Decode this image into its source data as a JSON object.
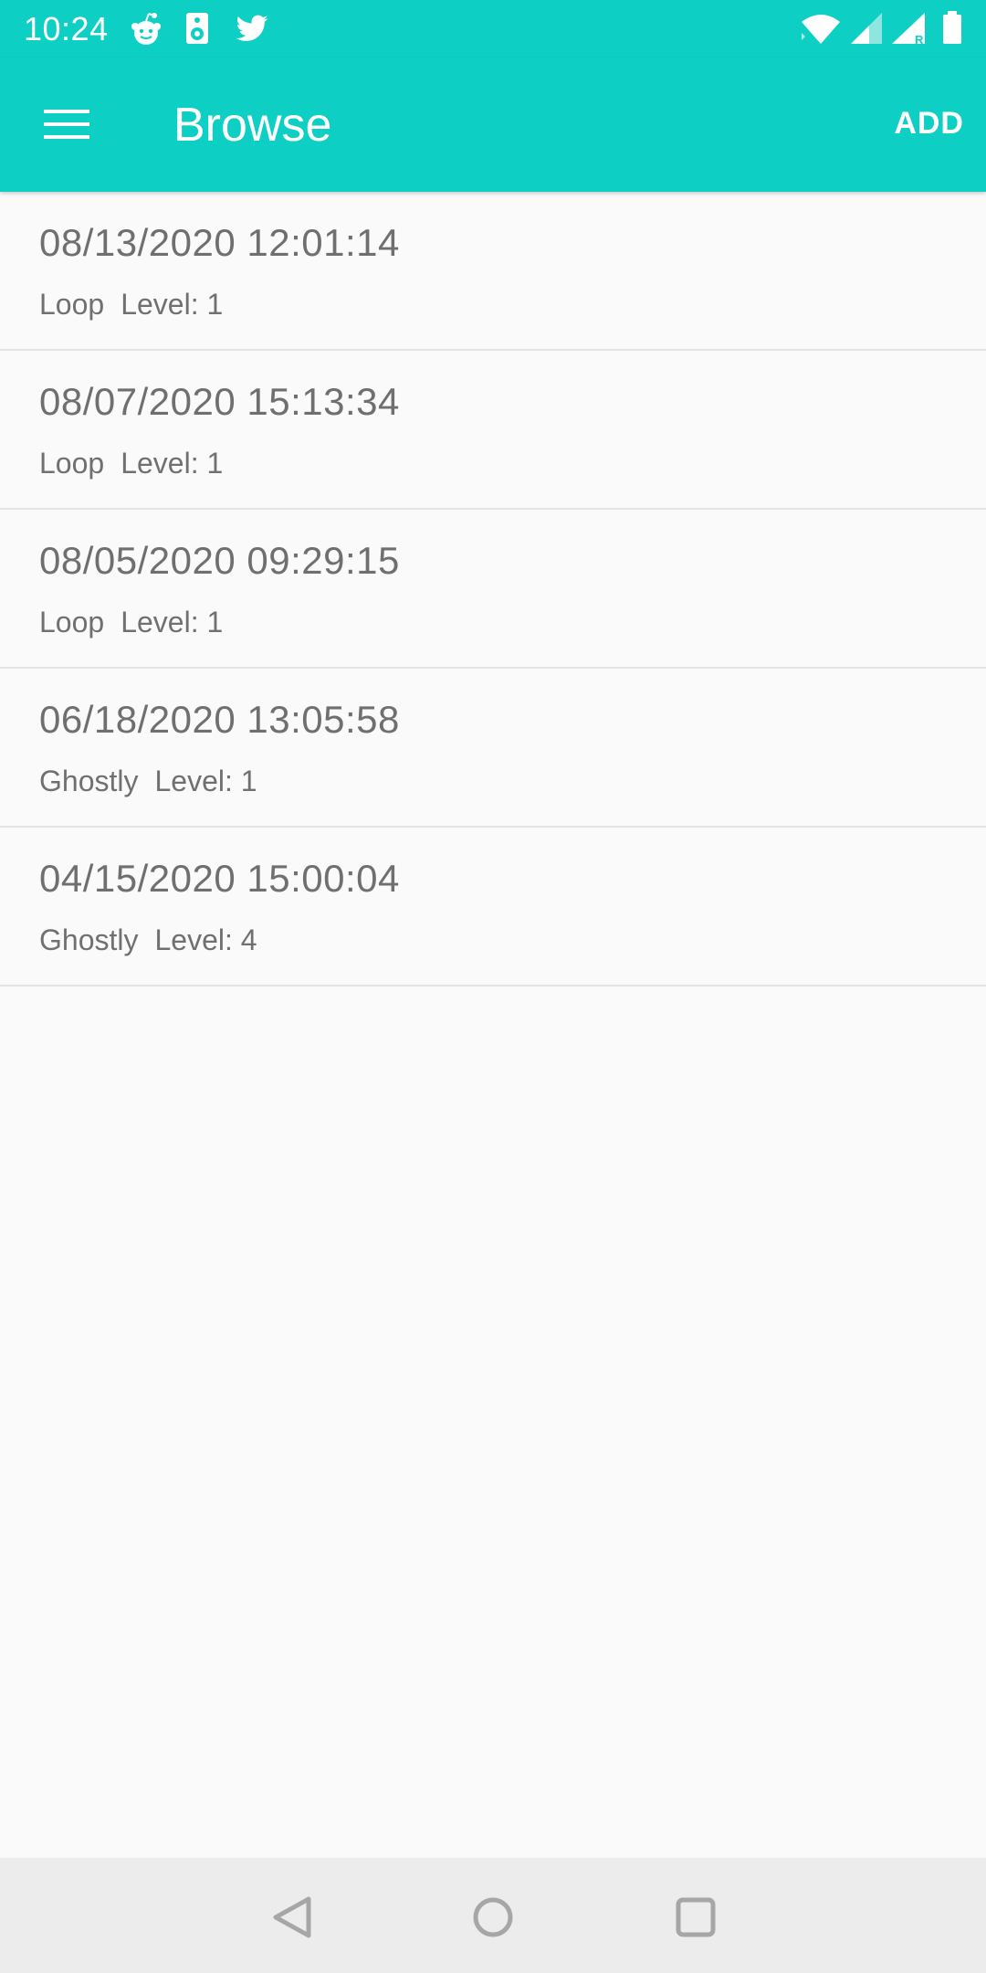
{
  "status_bar": {
    "time": "10:24",
    "icons": [
      "reddit-icon",
      "speaker-icon",
      "twitter-icon",
      "wifi-icon",
      "signal-icon",
      "signal-roaming-icon",
      "battery-icon"
    ]
  },
  "app_bar": {
    "title": "Browse",
    "add_label": "ADD",
    "menu_icon": "hamburger-menu-icon"
  },
  "items": [
    {
      "date": "08/13/2020 12:01:14",
      "type": "Loop",
      "level": "Level: 1"
    },
    {
      "date": "08/07/2020 15:13:34",
      "type": "Loop",
      "level": "Level: 1"
    },
    {
      "date": "08/05/2020 09:29:15",
      "type": "Loop",
      "level": "Level: 1"
    },
    {
      "date": "06/18/2020 13:05:58",
      "type": "Ghostly",
      "level": "Level: 1"
    },
    {
      "date": "04/15/2020 15:00:04",
      "type": "Ghostly",
      "level": "Level: 4"
    }
  ],
  "nav_bar": {
    "icons": [
      "back-icon",
      "home-icon",
      "recents-icon"
    ]
  },
  "colors": {
    "accent": "#0dcfc4",
    "text_primary": "#6f6f6f",
    "background": "#fafafa"
  }
}
